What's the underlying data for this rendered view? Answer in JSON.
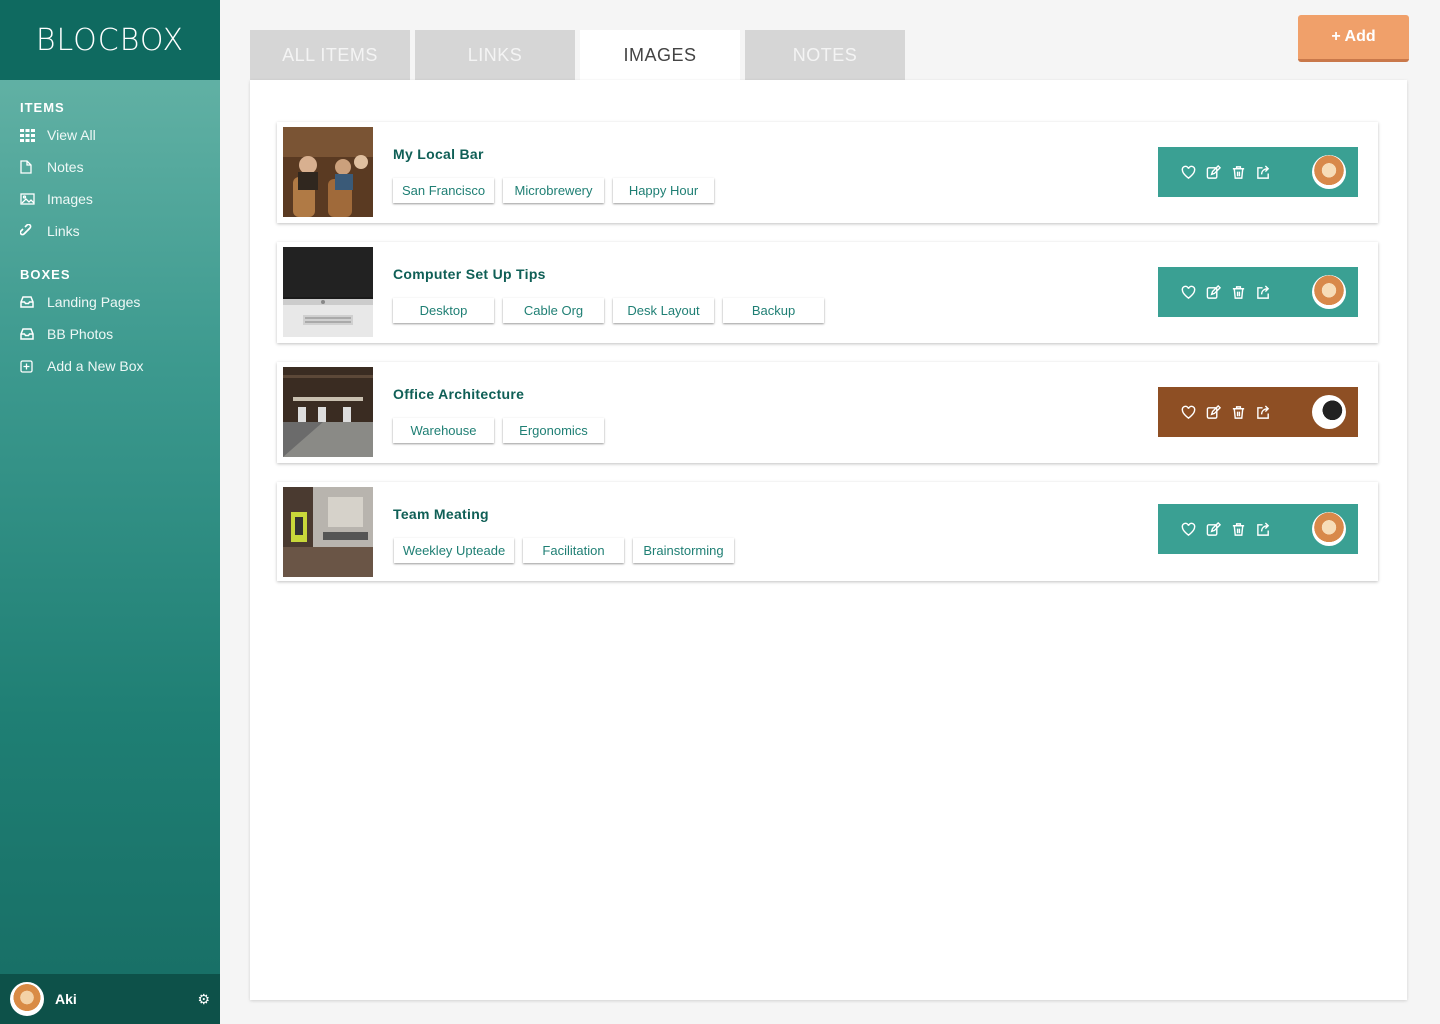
{
  "app": {
    "logo": "BLOCBOX"
  },
  "sidebar": {
    "items_heading": "ITEMS",
    "items": [
      {
        "label": "View All",
        "icon": "grid-icon"
      },
      {
        "label": "Notes",
        "icon": "document-icon"
      },
      {
        "label": "Images",
        "icon": "image-icon"
      },
      {
        "label": "Links",
        "icon": "link-icon"
      }
    ],
    "boxes_heading": "BOXES",
    "boxes": [
      {
        "label": "Landing Pages",
        "icon": "inbox-icon"
      },
      {
        "label": "BB Photos",
        "icon": "inbox-icon"
      },
      {
        "label": "Add a New Box",
        "icon": "plus-square-icon"
      }
    ],
    "user": {
      "name": "Aki"
    }
  },
  "tabs": [
    {
      "label": "ALL ITEMS",
      "active": false
    },
    {
      "label": "LINKS",
      "active": false
    },
    {
      "label": "IMAGES",
      "active": true
    },
    {
      "label": "NOTES",
      "active": false
    }
  ],
  "add_button": "+ Add",
  "cards": [
    {
      "title": "My Local Bar",
      "tags": [
        "San Francisco",
        "Microbrewery",
        "Happy Hour"
      ],
      "bar_color": "#3aa093"
    },
    {
      "title": "Computer Set Up Tips",
      "tags": [
        "Desktop",
        "Cable Org",
        "Desk Layout",
        "Backup"
      ],
      "bar_color": "#3aa093"
    },
    {
      "title": "Office Architecture",
      "tags": [
        "Warehouse",
        "Ergonomics"
      ],
      "bar_color": "#8e4f24"
    },
    {
      "title": "Team Meating",
      "tags": [
        "Weekley Upteade",
        "Facilitation",
        "Brainstorming"
      ],
      "bar_color": "#3aa093"
    }
  ],
  "colors": {
    "accent": "#1f7f74",
    "add_button": "#f0a06a",
    "tab_inactive": "#d6d6d6"
  }
}
